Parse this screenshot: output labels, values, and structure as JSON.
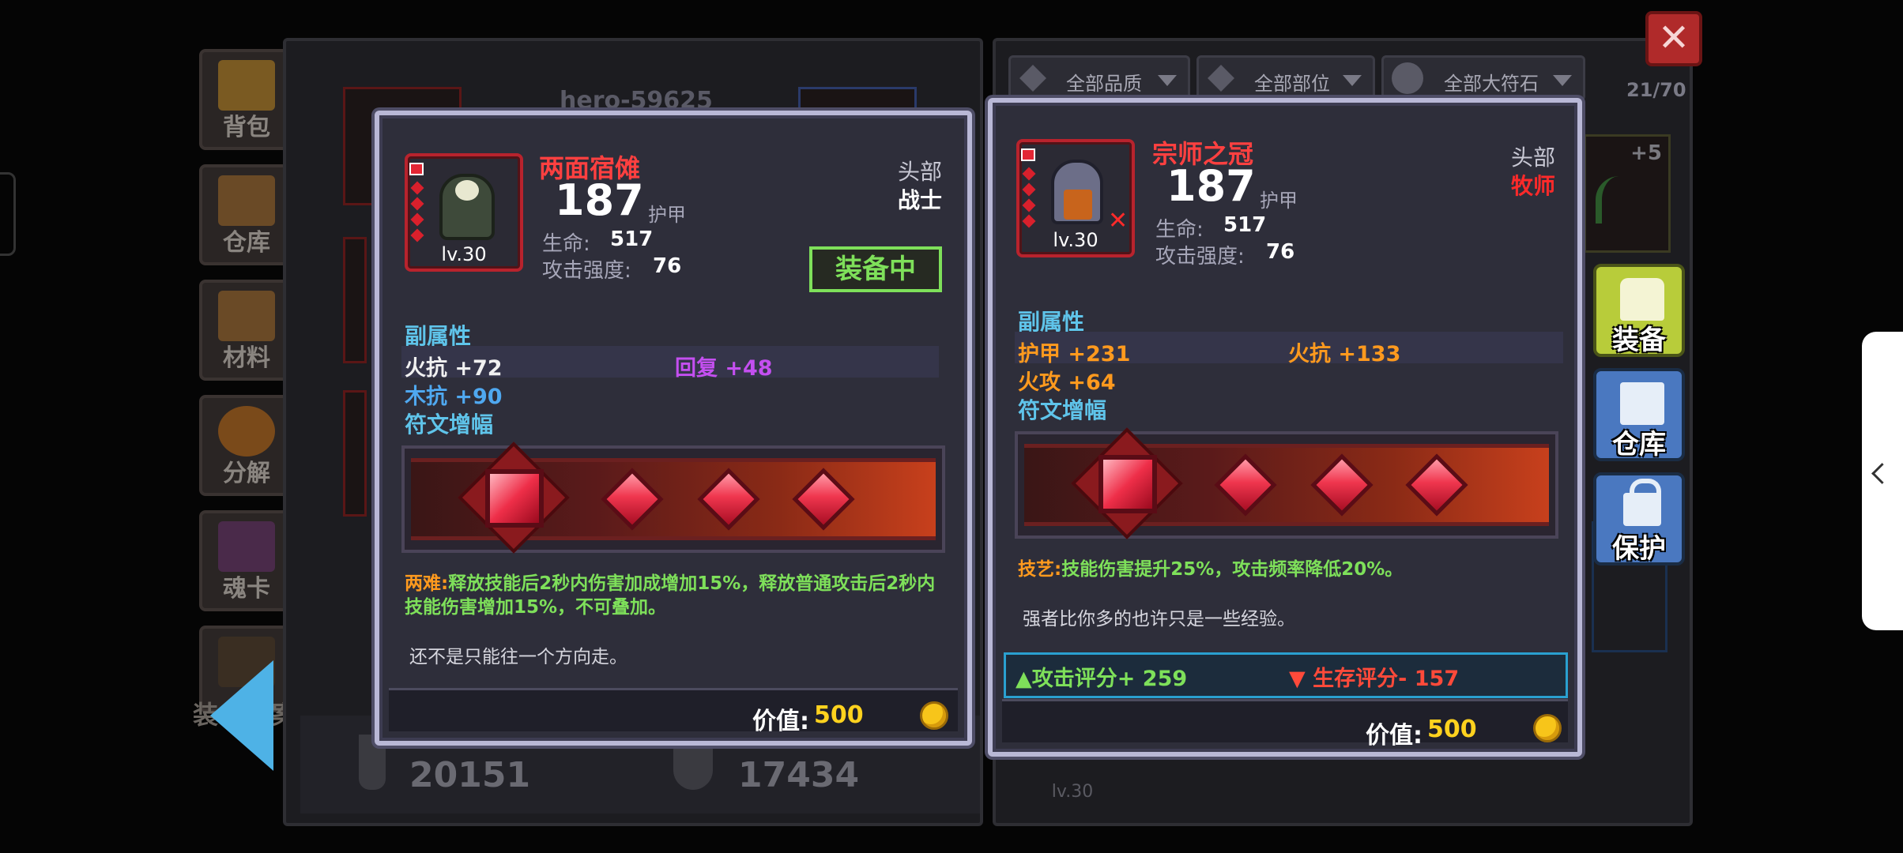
{
  "sidebar": [
    {
      "label": "背包",
      "color": "#7a5a22"
    },
    {
      "label": "仓库",
      "color": "#6a4a26"
    },
    {
      "label": "材料",
      "color": "#6a4a26"
    },
    {
      "label": "分解",
      "color": "#7a4a1a"
    },
    {
      "label": "魂卡",
      "color": "#4a2a4a"
    },
    {
      "label": "装",
      "color": "#3a2e22"
    }
  ],
  "background": {
    "player_name": "hero-59625",
    "score_left": "20151",
    "score_right": "17434",
    "bottom_lv": "lv.30",
    "inventory_count": "21/70",
    "slot_plus": "+5",
    "archive_suffix": "案"
  },
  "filters": [
    {
      "label": "全部品质"
    },
    {
      "label": "全部部位"
    },
    {
      "label": "全部大符石"
    }
  ],
  "actions": {
    "equip": "装备",
    "storage": "仓库",
    "protect": "保护"
  },
  "equipped_item": {
    "name": "两面宿傩",
    "armor": "187",
    "armor_label": "护甲",
    "level": "lv.30",
    "slot": "头部",
    "class": "战士",
    "hp_label": "生命:",
    "hp": "517",
    "atk_label": "攻击强度:",
    "atk": "76",
    "status": "装备中",
    "sub_title": "副属性",
    "affixes": [
      {
        "text": "火抗 +72",
        "color": "#ffffff"
      },
      {
        "text": "回复 +48",
        "color": "#c44ff0"
      },
      {
        "text": "木抗 +90",
        "color": "#4fa8f0"
      }
    ],
    "rune_title": "符文增幅",
    "desc_prefix": "两难:",
    "desc_body": "释放技能后2秒内伤害加成增加15%，释放普通攻击后2秒内技能伤害增加15%，不可叠加。",
    "flavor": "还不是只能往一个方向走。",
    "value_label": "价值:",
    "value": "500"
  },
  "compared_item": {
    "name": "宗师之冠",
    "armor": "187",
    "armor_label": "护甲",
    "level": "lv.30",
    "slot": "头部",
    "class": "牧师",
    "class_color": "#ff2a2a",
    "hp_label": "生命:",
    "hp": "517",
    "atk_label": "攻击强度:",
    "atk": "76",
    "sub_title": "副属性",
    "affixes": [
      {
        "text": "护甲 +231",
        "color": "#ff9a1e"
      },
      {
        "text": "火抗 +133",
        "color": "#ff9a1e"
      },
      {
        "text": "火攻 +64",
        "color": "#ff9a1e"
      }
    ],
    "rune_title": "符文增幅",
    "desc_prefix": "技艺:",
    "desc_body": "技能伤害提升25%，攻击频率降低20%。",
    "flavor": "强者比你多的也许只是一些经验。",
    "attack_score": "▲攻击评分+ 259",
    "survival_score": "▼ 生存评分- 157",
    "value_label": "价值:",
    "value": "500"
  },
  "colors": {
    "item_name": "#ff4040",
    "section": "#5fc4ea",
    "desc_prefix": "#ff9a1e",
    "desc_body": "#7ee05a",
    "equipped_badge": "#7ee05a",
    "attack_up": "#7ee05a",
    "survival_down": "#ff4a3a",
    "value": "#ffd21e"
  },
  "icons": {
    "close": "close-icon",
    "back": "back-arrow-icon",
    "drawer": "chevron-left-icon",
    "coin": "gold-coin-icon"
  }
}
